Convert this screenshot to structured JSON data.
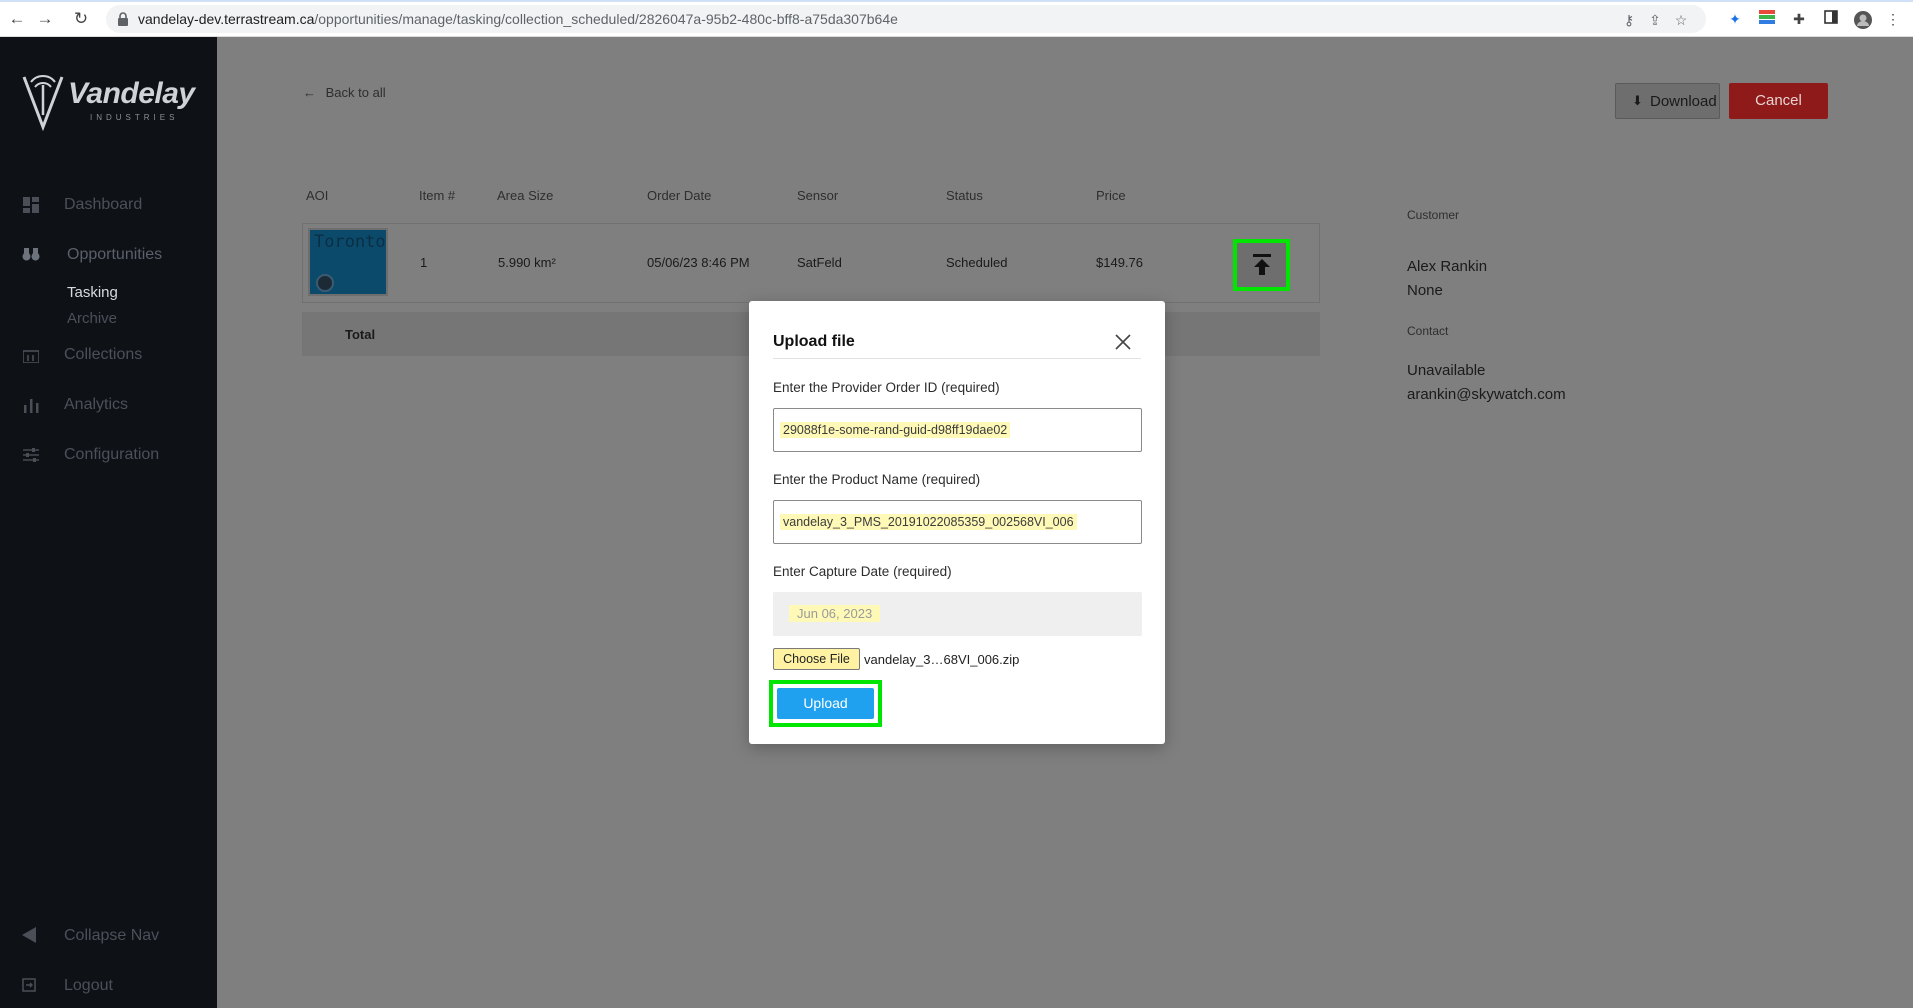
{
  "browser": {
    "url_host": "vandelay-dev.terrastream.ca",
    "url_path": "/opportunities/manage/tasking/collection_scheduled/2826047a-95b2-480c-bff8-a75da307b64e"
  },
  "sidebar": {
    "logo_text": "Vandelay",
    "logo_subtext": "INDUSTRIES",
    "items": [
      {
        "label": "Dashboard",
        "icon": "dashboard-icon"
      },
      {
        "label": "Opportunities",
        "icon": "binoculars-icon"
      },
      {
        "label": "Collections",
        "icon": "collections-icon"
      },
      {
        "label": "Analytics",
        "icon": "analytics-icon"
      },
      {
        "label": "Configuration",
        "icon": "sliders-icon"
      }
    ],
    "sub_items": [
      "Tasking",
      "Archive"
    ],
    "collapse_label": "Collapse Nav",
    "logout_label": "Logout"
  },
  "header": {
    "back_label": "Back to all",
    "download_label": "Download",
    "cancel_label": "Cancel"
  },
  "table": {
    "columns": [
      "AOI",
      "Item #",
      "Area Size",
      "Order Date",
      "Sensor",
      "Status",
      "Price"
    ],
    "row": {
      "aoi_thumb_text": "Toronto",
      "item": "1",
      "area": "5.990 km²",
      "order_date": "05/06/23 8:46 PM",
      "sensor": "SatFeld",
      "status": "Scheduled",
      "price": "$149.76"
    },
    "total_label": "Total"
  },
  "customer": {
    "customer_label": "Customer",
    "name": "Alex Rankin",
    "org": "None",
    "contact_label": "Contact",
    "phone": "Unavailable",
    "email": "arankin@skywatch.com"
  },
  "modal": {
    "title": "Upload file",
    "provider_label": "Enter the Provider Order ID (required)",
    "provider_value": "29088f1e-some-rand-guid-d98ff19dae02",
    "product_label": "Enter the Product Name (required)",
    "product_value": "vandelay_3_PMS_20191022085359_002568VI_006",
    "date_label": "Enter Capture Date (required)",
    "date_value": "Jun 06, 2023",
    "choose_file_label": "Choose File",
    "file_name": "vandelay_3…68VI_006.zip",
    "upload_label": "Upload"
  },
  "colors": {
    "highlight": "#00e600",
    "upload_button": "#1fa1f0",
    "cancel_button": "#8f1a1a",
    "sidebar": "#0e1116"
  }
}
